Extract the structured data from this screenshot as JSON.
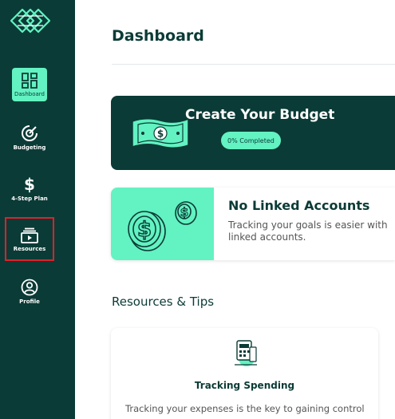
{
  "sidebar": {
    "items": [
      {
        "label": "Dashboard",
        "icon": "dashboard-grid-icon",
        "active": true
      },
      {
        "label": "Budgeting",
        "icon": "target-icon"
      },
      {
        "label": "4-Step Plan",
        "icon": "dollar-icon"
      },
      {
        "label": "Resources",
        "icon": "play-folder-icon"
      },
      {
        "label": "Profile",
        "icon": "user-icon"
      }
    ]
  },
  "main": {
    "title": "Dashboard",
    "budget_card": {
      "title": "Create Your Budget",
      "progress_label": "0% Completed",
      "progress": 0
    },
    "accounts_card": {
      "title": "No Linked Accounts",
      "description": "Tracking your goals is easier with linked accounts."
    },
    "resources": {
      "section_title": "Resources & Tips",
      "cards": [
        {
          "title": "Tracking Spending",
          "description": "Tracking your expenses is the key to gaining control"
        }
      ]
    }
  },
  "colors": {
    "sidebar": "#0b3b36",
    "accent": "#63f2c1",
    "highlight": "#e0202a"
  }
}
